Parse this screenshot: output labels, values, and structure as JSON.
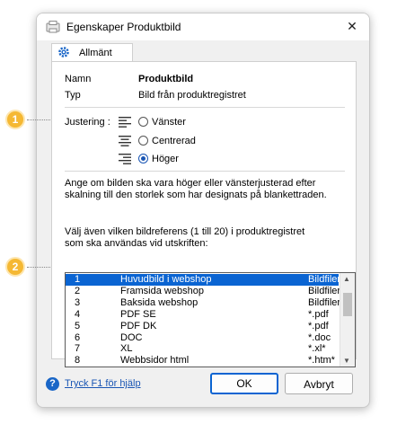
{
  "window": {
    "title": "Egenskaper Produktbild"
  },
  "tab": {
    "label": "Allmänt"
  },
  "fields": {
    "name_label": "Namn",
    "name_value": "Produktbild",
    "type_label": "Typ",
    "type_value": "Bild från produktregistret"
  },
  "alignment": {
    "label": "Justering :",
    "options": [
      "Vänster",
      "Centrerad",
      "Höger"
    ],
    "selected": "Höger"
  },
  "description": {
    "line1": "Ange om bilden ska vara höger eller vänsterjusterad efter",
    "line2": "skalning till den storlek som har designats på blankettraden.",
    "line3": "Välj även vilken bildreferens (1 till 20) i produktregistret",
    "line4": "som ska användas vid utskriften:"
  },
  "image_list": {
    "rows": [
      {
        "num": "1",
        "name": "Huvudbild i webshop",
        "type": "Bildfiler"
      },
      {
        "num": "2",
        "name": "Framsida webshop",
        "type": "Bildfiler"
      },
      {
        "num": "3",
        "name": "Baksida webshop",
        "type": "Bildfiler"
      },
      {
        "num": "4",
        "name": "PDF SE",
        "type": "*.pdf"
      },
      {
        "num": "5",
        "name": "PDF DK",
        "type": "*.pdf"
      },
      {
        "num": "6",
        "name": "DOC",
        "type": "*.doc"
      },
      {
        "num": "7",
        "name": "XL",
        "type": "*.xl*"
      },
      {
        "num": "8",
        "name": "Webbsidor html",
        "type": "*.htm*"
      }
    ],
    "selected_index": 0
  },
  "footer": {
    "help_text": "Tryck F1 för hjälp",
    "ok_label": "OK",
    "cancel_label": "Avbryt"
  },
  "callouts": [
    "1",
    "2"
  ],
  "colors": {
    "accent": "#0a64d2",
    "callout": "#f5b833"
  }
}
